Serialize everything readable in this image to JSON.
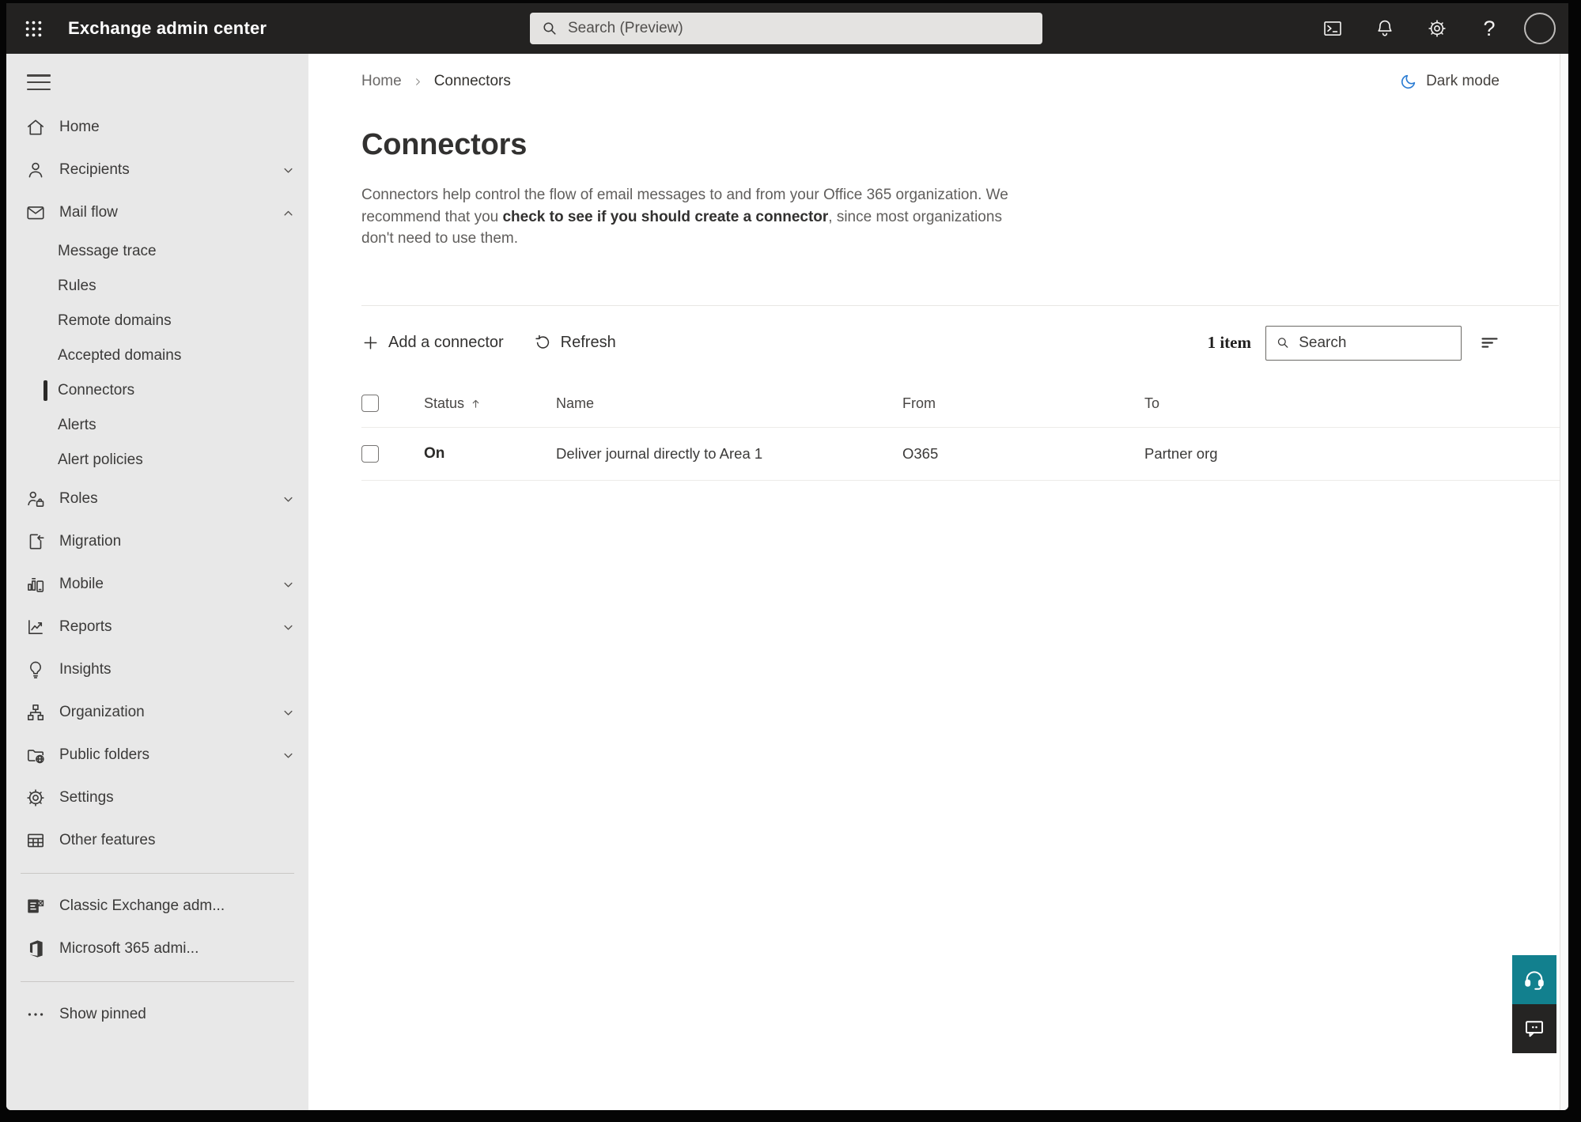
{
  "topbar": {
    "app_title": "Exchange admin center",
    "search_placeholder": "Search (Preview)"
  },
  "breadcrumb": {
    "home": "Home",
    "current": "Connectors"
  },
  "dark_mode_label": "Dark mode",
  "page": {
    "title": "Connectors",
    "description_part1": "Connectors help control the flow of email messages to and from your Office 365 organization. We recommend that you ",
    "description_emphasis": "check to see if you should create a connector",
    "description_part2": ", since most organizations don't need to use them."
  },
  "toolbar": {
    "add_label": "Add a connector",
    "refresh_label": "Refresh",
    "items_count": "1 item",
    "search_placeholder": "Search"
  },
  "table": {
    "headers": {
      "status": "Status",
      "name": "Name",
      "from": "From",
      "to": "To"
    },
    "rows": [
      {
        "status": "On",
        "name": "Deliver journal directly to Area 1",
        "from": "O365",
        "to": "Partner org"
      }
    ]
  },
  "sidebar": {
    "items": [
      {
        "id": "home",
        "label": "Home",
        "icon": "home",
        "type": "top"
      },
      {
        "id": "recipients",
        "label": "Recipients",
        "icon": "recipients",
        "type": "top",
        "chevron": "down"
      },
      {
        "id": "mail-flow",
        "label": "Mail flow",
        "icon": "mailflow",
        "type": "top",
        "chevron": "up"
      },
      {
        "id": "message-trace",
        "label": "Message trace",
        "type": "sub"
      },
      {
        "id": "rules",
        "label": "Rules",
        "type": "sub"
      },
      {
        "id": "remote-domains",
        "label": "Remote domains",
        "type": "sub"
      },
      {
        "id": "accepted-domains",
        "label": "Accepted domains",
        "type": "sub"
      },
      {
        "id": "connectors",
        "label": "Connectors",
        "type": "sub",
        "selected": true
      },
      {
        "id": "alerts",
        "label": "Alerts",
        "type": "sub"
      },
      {
        "id": "alert-policies",
        "label": "Alert policies",
        "type": "sub"
      },
      {
        "id": "roles",
        "label": "Roles",
        "icon": "roles",
        "type": "top",
        "chevron": "down"
      },
      {
        "id": "migration",
        "label": "Migration",
        "icon": "migration",
        "type": "top"
      },
      {
        "id": "mobile",
        "label": "Mobile",
        "icon": "mobile",
        "type": "top",
        "chevron": "down"
      },
      {
        "id": "reports",
        "label": "Reports",
        "icon": "reports",
        "type": "top",
        "chevron": "down"
      },
      {
        "id": "insights",
        "label": "Insights",
        "icon": "insights",
        "type": "top"
      },
      {
        "id": "organization",
        "label": "Organization",
        "icon": "organization",
        "type": "top",
        "chevron": "down"
      },
      {
        "id": "public-folders",
        "label": "Public folders",
        "icon": "public-folders",
        "type": "top",
        "chevron": "down"
      },
      {
        "id": "settings",
        "label": "Settings",
        "icon": "settings",
        "type": "top"
      },
      {
        "id": "other-features",
        "label": "Other features",
        "icon": "other-features",
        "type": "top"
      },
      {
        "id": "classic-exchange",
        "label": "Classic Exchange adm...",
        "icon": "classic-exchange",
        "type": "top",
        "divider_before": true
      },
      {
        "id": "microsoft-365",
        "label": "Microsoft 365 admi...",
        "icon": "microsoft-365",
        "type": "top"
      },
      {
        "id": "show-pinned",
        "label": "Show pinned",
        "icon": "dots",
        "type": "top",
        "divider_before": true
      }
    ]
  },
  "colors": {
    "topbar_bg": "#232221",
    "sidebar_bg": "#e8e8e8",
    "accent_teal": "#12808e",
    "chat_button": "#252423",
    "moon_blue": "#2b7cd3",
    "selected_marker": "#2b2a28"
  }
}
